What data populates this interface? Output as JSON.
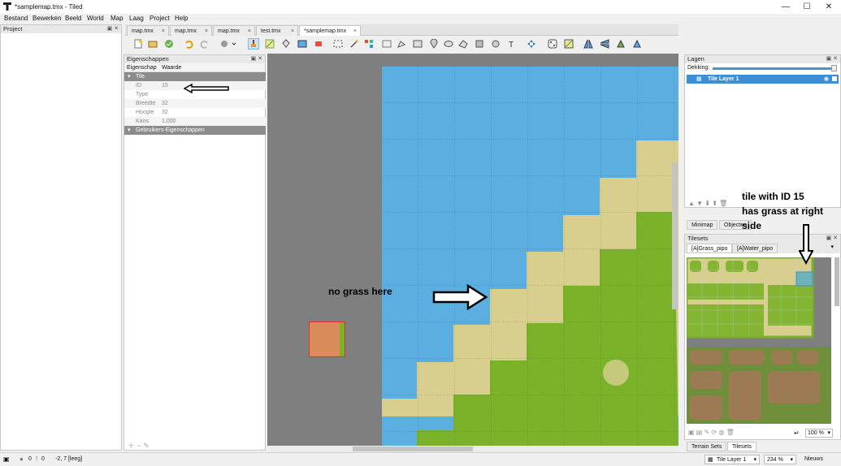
{
  "window": {
    "title": "*samplemap.tmx - Tiled",
    "minimize": "—",
    "maximize": "☐",
    "close": "✕"
  },
  "menu": [
    "Bestand",
    "Bewerken",
    "Beeld",
    "World",
    "Map",
    "Laag",
    "Project",
    "Help"
  ],
  "project_panel": {
    "title": "Project"
  },
  "tabs": [
    {
      "label": "map.tmx"
    },
    {
      "label": "map.tmx"
    },
    {
      "label": "map.tmx"
    },
    {
      "label": "test.tmx"
    },
    {
      "label": "*samplemap.tmx",
      "active": true
    }
  ],
  "tab_close": "×",
  "properties": {
    "title": "Eigenschappen",
    "col_property": "Eigenschap",
    "col_value": "Waarde",
    "group_tile": "Tile",
    "rows": [
      {
        "key": "ID",
        "value": "15"
      },
      {
        "key": "Type",
        "value": ""
      },
      {
        "key": "Breedte",
        "value": "32"
      },
      {
        "key": "Hoogte",
        "value": "32"
      },
      {
        "key": "Kans",
        "value": "1,000"
      }
    ],
    "group_custom": "Gebruikers-Eigenschappen"
  },
  "layers": {
    "title": "Lagen",
    "opacity_label": "Dekking:",
    "items": [
      {
        "name": "Tile Layer 1"
      }
    ]
  },
  "lower_tabs": [
    {
      "label": "Minimap"
    },
    {
      "label": "Objecten"
    }
  ],
  "tilesets": {
    "title": "Tilesets",
    "tabs": [
      {
        "label": "[A]Grass_pipo",
        "active": true
      },
      {
        "label": "[A]Water_pipo"
      }
    ],
    "zoom": "100 %"
  },
  "bottom_tabs": [
    {
      "label": "Terrain Sets"
    },
    {
      "label": "Tilesets",
      "active": true
    }
  ],
  "annotations": {
    "no_grass": "no grass here",
    "tile_line1": "tile with ID 15",
    "tile_line2": "has grass at right",
    "tile_line3": "side"
  },
  "status": {
    "errors": "0",
    "warnings": "0",
    "coords": "-2, 7 [leeg]",
    "layer": "Tile Layer 1",
    "zoom": "234 %",
    "news": "Nieuws"
  },
  "colors": {
    "water": "#5aaee0",
    "sand": "#d8cf8e",
    "grass": "#7ab32a",
    "selection": "#3a8fd6"
  }
}
